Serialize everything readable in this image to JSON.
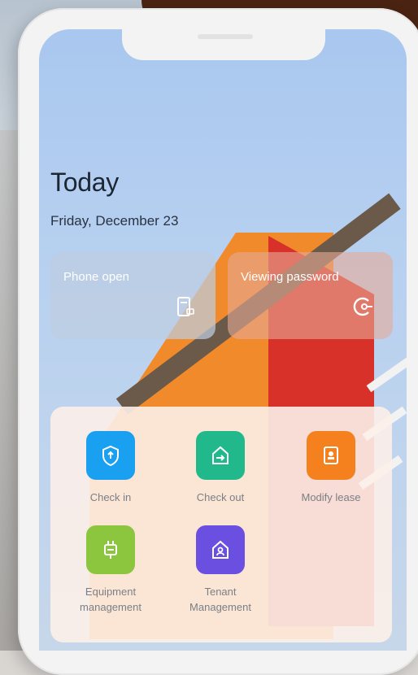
{
  "widget": {
    "title": "Today",
    "date": "Friday, December 23"
  },
  "quick_cards": [
    {
      "label": "Phone open",
      "icon": "phone-door-icon"
    },
    {
      "label": "Viewing password",
      "icon": "key-icon"
    }
  ],
  "apps": [
    {
      "label": "Check in",
      "icon": "shield-icon",
      "color": "#1aa0f0"
    },
    {
      "label": "Check out",
      "icon": "house-arrow-icon",
      "color": "#21b98b"
    },
    {
      "label": "Modify lease",
      "icon": "contract-icon",
      "color": "#f5801e"
    },
    {
      "label": "Equipment management",
      "icon": "plug-icon",
      "color": "#8bc63e"
    },
    {
      "label": "Tenant Management",
      "icon": "tenant-house-icon",
      "color": "#6a4fe0"
    }
  ]
}
